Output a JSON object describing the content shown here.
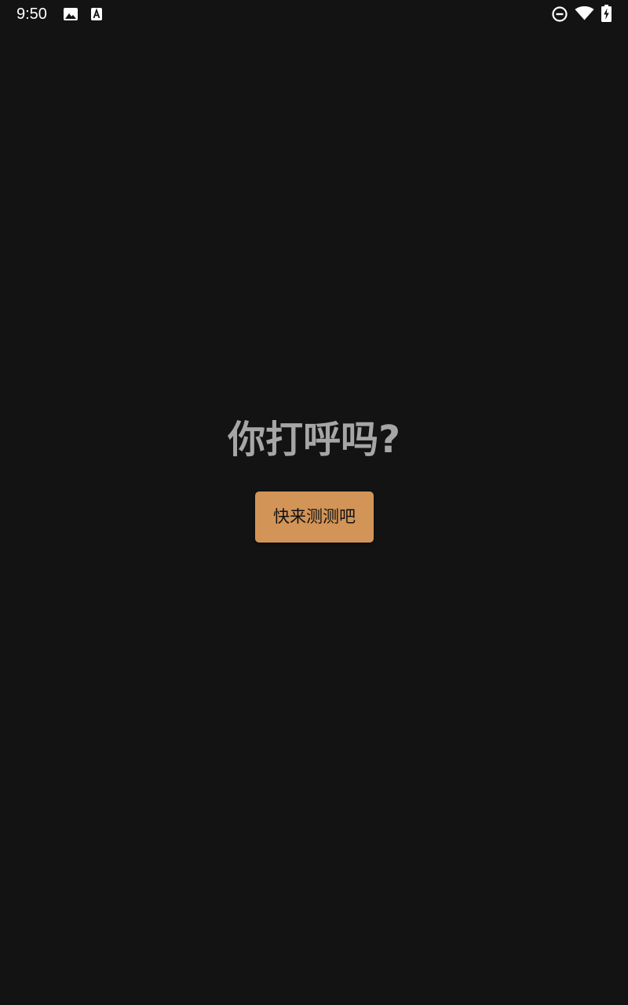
{
  "status_bar": {
    "time": "9:50",
    "icons": [
      "image-icon",
      "text-a-icon",
      "do-not-disturb-icon",
      "wifi-icon",
      "battery-charging-icon"
    ]
  },
  "main": {
    "title": "你打呼吗?",
    "button_label": "快来测测吧"
  },
  "colors": {
    "background": "#131313",
    "title_text": "#a6a6a6",
    "button_bg": "#d29457",
    "button_text": "#111111",
    "status_icons": "#ffffff"
  }
}
